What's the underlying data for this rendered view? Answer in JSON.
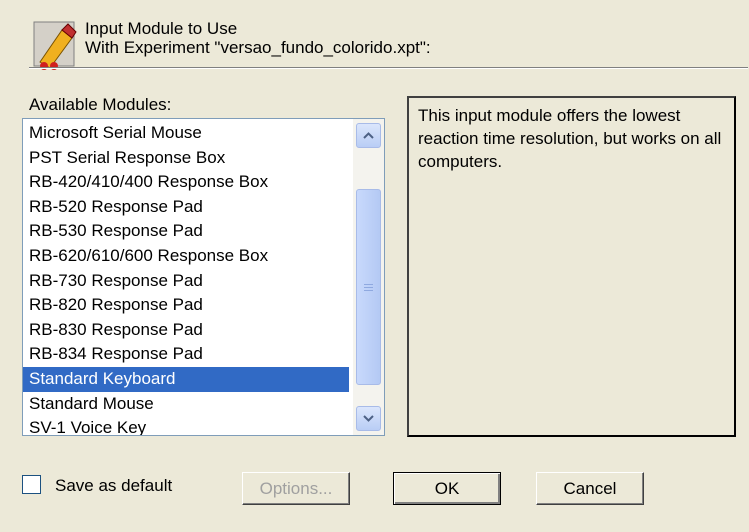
{
  "header": {
    "title_line1": "Input Module to Use",
    "title_line2": "With Experiment \"versao_fundo_colorido.xpt\":"
  },
  "available_label": "Available Modules:",
  "modules": [
    "Microsoft Serial Mouse",
    "PST Serial Response Box",
    "RB-420/410/400 Response Box",
    "RB-520 Response Pad",
    "RB-530 Response Pad",
    "RB-620/610/600 Response Box",
    "RB-730 Response Pad",
    "RB-820 Response Pad",
    "RB-830 Response Pad",
    "RB-834 Response Pad",
    "Standard Keyboard",
    "Standard Mouse",
    "SV-1 Voice Key"
  ],
  "selected_module": "Standard Keyboard",
  "description": "This input module offers the lowest reaction time resolution, but works on all computers.",
  "save_default_label": "Save as default",
  "save_default_checked": false,
  "buttons": {
    "options": "Options...",
    "ok": "OK",
    "cancel": "Cancel"
  },
  "colors": {
    "dialog_bg": "#ece9d8",
    "selection": "#316ac5",
    "disabled_text": "#a0a0a0"
  },
  "icons": {
    "header": "input-module-icon",
    "scroll_up": "chevron-up-icon",
    "scroll_down": "chevron-down-icon"
  }
}
